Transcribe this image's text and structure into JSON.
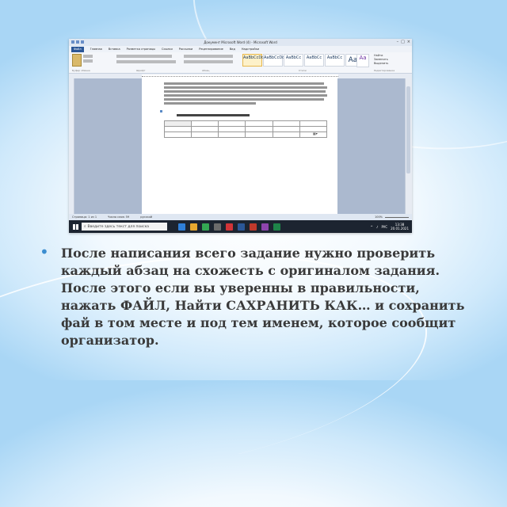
{
  "slide": {
    "bullet_symbol": "•",
    "text": "После написания всего задание нужно проверить каждый абзац на схожесть с оригиналом задания. После этого если вы уверенны в правильности, нажать ФАЙЛ, Найти САХРАНИТЬ КАК… и сохранить фай в том месте и под тем именем,  которое сообщит организатор."
  },
  "screenshot": {
    "title": "Документ Microsoft Word (4) - Microsoft Word",
    "menu": [
      "Файл",
      "Главная",
      "Вставка",
      "Разметка страницы",
      "Ссылки",
      "Рассылки",
      "Рецензирование",
      "Вид",
      "Надстройки"
    ],
    "style_presets": [
      "AaBbCcDd",
      "AaBbCcDd",
      "AaBbCc",
      "AaBbCc",
      "AaBbCc",
      "AaB"
    ],
    "aa_glyph": "Aa",
    "edit_items": [
      "Найти",
      "Заменить",
      "Выделить"
    ],
    "ribbon_groups": [
      "Буфер обмена",
      "Шрифт",
      "Абзац",
      "Стили",
      "Редактирование"
    ],
    "status": [
      "Страница: 1 из 1",
      "Число слов: 59",
      "русский"
    ],
    "zoom": "100%",
    "taskbar_search_placeholder": "Введите здесь текст для поиска",
    "tray_lang": "РУС",
    "clock_time": "13:38",
    "clock_date": "20.01.2021"
  },
  "colors": {
    "accent": "#3c8ed0",
    "taskbar": "#1c2430",
    "word_blue": "#2b5797"
  }
}
